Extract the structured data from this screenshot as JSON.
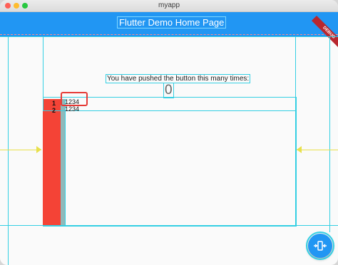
{
  "window": {
    "title": "myapp"
  },
  "appbar": {
    "title": "Flutter Demo Home Page",
    "color": "#2196f3",
    "banner": "DEBUG"
  },
  "body": {
    "message": "You have pushed the button this many times:",
    "counter": "0"
  },
  "list": {
    "rows": [
      {
        "index": "1",
        "value": "1234"
      },
      {
        "index": "2",
        "value": "1234"
      }
    ],
    "accent_color": "#f44336"
  },
  "fab": {
    "icon": "widget-inspector-icon"
  },
  "colors": {
    "guideline": "#34cfe3",
    "highlight": "#e53935"
  }
}
